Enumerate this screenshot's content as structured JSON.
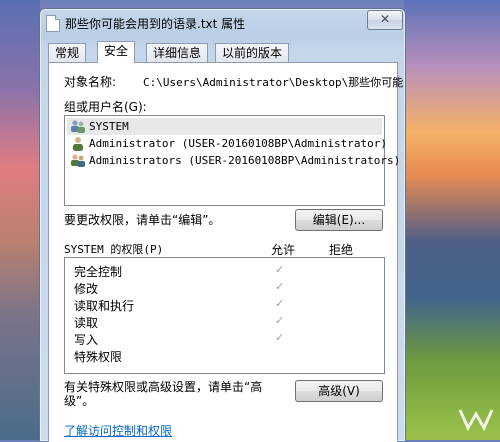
{
  "window": {
    "title": "那些你可能会用到的语录.txt 属性",
    "close_label": "✕"
  },
  "tabs": [
    {
      "label": "常规"
    },
    {
      "label": "安全"
    },
    {
      "label": "详细信息"
    },
    {
      "label": "以前的版本"
    }
  ],
  "security": {
    "object_name_label": "对象名称:",
    "object_name_value": "C:\\Users\\Administrator\\Desktop\\那些你可能",
    "group_label": "组或用户名(G):",
    "users": [
      {
        "name": "SYSTEM"
      },
      {
        "name": "Administrator (USER-20160108BP\\Administrator)"
      },
      {
        "name": "Administrators (USER-20160108BP\\Administrators)"
      }
    ],
    "edit_hint": "要更改权限，请单击“编辑”。",
    "edit_button": "编辑(E)...",
    "permissions_for": "SYSTEM 的权限(P)",
    "allow_header": "允许",
    "deny_header": "拒绝",
    "permissions": [
      {
        "name": "完全控制",
        "allow": "✓",
        "deny": ""
      },
      {
        "name": "修改",
        "allow": "✓",
        "deny": ""
      },
      {
        "name": "读取和执行",
        "allow": "✓",
        "deny": ""
      },
      {
        "name": "读取",
        "allow": "✓",
        "deny": ""
      },
      {
        "name": "写入",
        "allow": "✓",
        "deny": ""
      },
      {
        "name": "特殊权限",
        "allow": "",
        "deny": ""
      }
    ],
    "advanced_hint_line1": "有关特殊权限或高级设置，请单击“高",
    "advanced_hint_line2": "级”。",
    "advanced_button": "高级(V)",
    "help_link": "了解访问控制和权限"
  }
}
